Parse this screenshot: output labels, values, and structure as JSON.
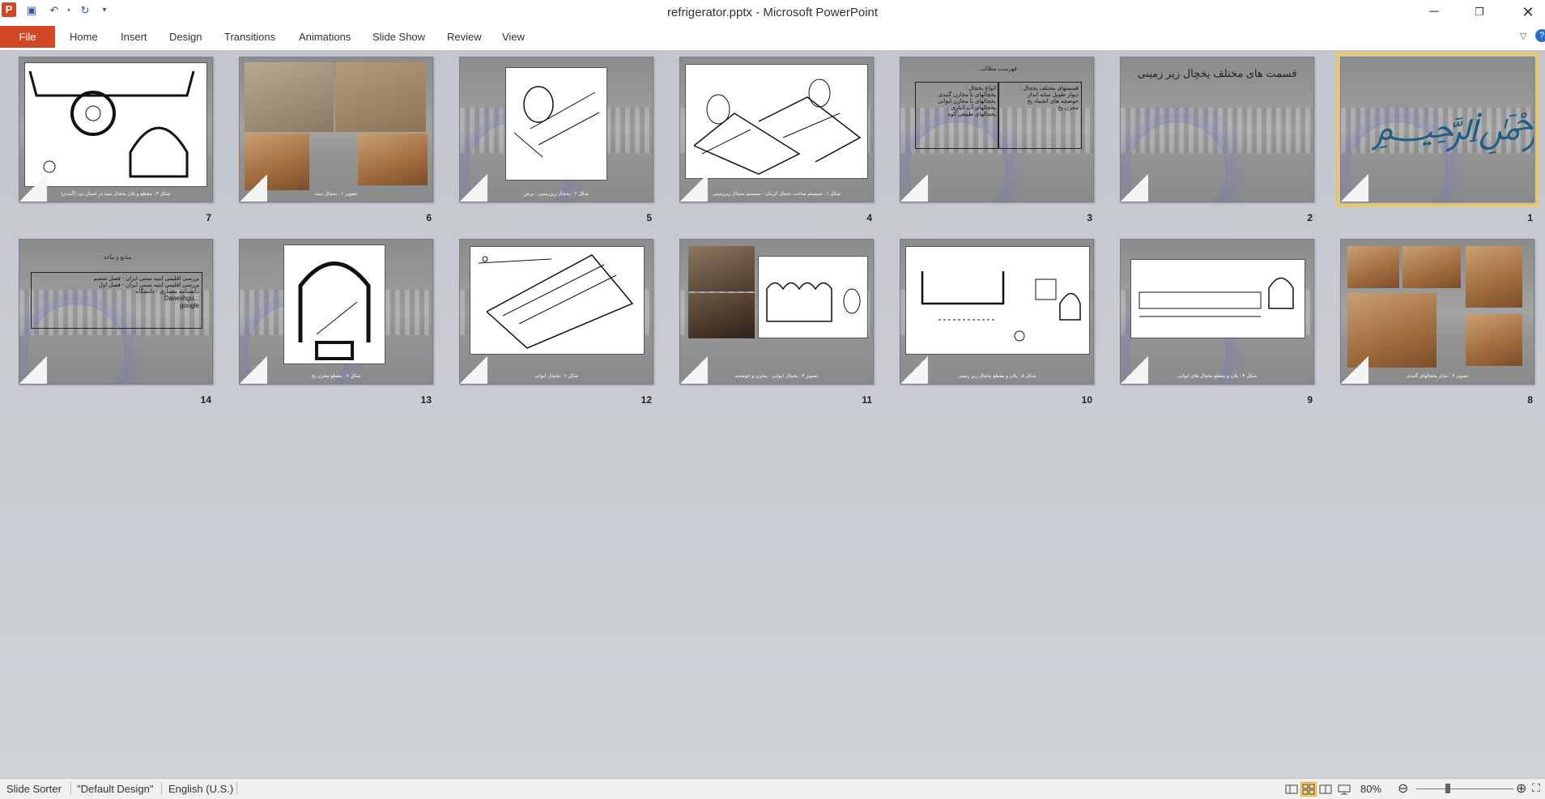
{
  "titlebar": {
    "app_icon": "P",
    "title": "refrigerator.pptx  -  Microsoft PowerPoint",
    "qat": [
      "save-icon",
      "undo-icon",
      "redo-icon",
      "customize-icon"
    ],
    "controls": [
      "minimize-icon",
      "restore-icon",
      "close-icon"
    ]
  },
  "ribbon": {
    "file": "File",
    "tabs": [
      "Home",
      "Insert",
      "Design",
      "Transitions",
      "Animations",
      "Slide Show",
      "Review",
      "View"
    ]
  },
  "slides": [
    {
      "number": "1",
      "selected": true
    },
    {
      "number": "2",
      "title": "قسمت های مختلف یخچال زیر زمینی"
    },
    {
      "number": "3",
      "title": "فهرست مطالب :",
      "col1": [
        "قسمتهای مختلف یخچال :",
        "دیوار طویل سایه انداز",
        "حوضچه های انجماد یخ",
        "مخزن یخ"
      ],
      "col2": [
        "انواع یخچال :",
        "یخچالهای با مخازن گنبدی",
        "یخچالهای با مخازن ایوانی",
        "یخچالهای آب انباری",
        "یخچالهای طبیعی کوه"
      ]
    },
    {
      "number": "4",
      "caption": "شکل ۱ : سیستم ساخت یخچال کرمان - سیستم یخچال زیرزمینی"
    },
    {
      "number": "5",
      "caption": "شکل ۲ : یخچال زیرزمینی - برش"
    },
    {
      "number": "6",
      "caption": "تصویر ۱ : یخچال میبد"
    },
    {
      "number": "7",
      "caption": "شکل ۳ : مقطع و پلان یخچال میبد در استان یزد (گنبدی)"
    },
    {
      "number": "8",
      "caption": "تصویر ۲ : نمای یخچالهای گنبدی"
    },
    {
      "number": "9",
      "caption": "شکل ۴ : پلان و مقطع یخچال های ایوانی"
    },
    {
      "number": "10",
      "caption": "شکل ۵ : پلان و مقطع یخچال زیر زمینی"
    },
    {
      "number": "11",
      "caption": "تصویر ۳ : یخچال ایوانی - مخزن و حوضچه"
    },
    {
      "number": "12",
      "caption": "شکل ۶ : یخچال ایوانی"
    },
    {
      "number": "13",
      "caption": "شکل ۷ : مقطع مخزن یخ"
    },
    {
      "number": "14",
      "title": "منابع و مآخذ :",
      "items": [
        "بررسی اقلیمی ابنیه سنتی ایران - فصل ششم",
        "بررسی اقلیمی ابنیه سنتی ایران - فصل اول",
        "دانشنامه معماری - دانشگاه"
      ],
      "extra": [
        "Daneshgu...",
        "google"
      ]
    }
  ],
  "statusbar": {
    "view": "Slide Sorter",
    "theme": "\"Default Design\"",
    "language": "English (U.S.)",
    "zoom": "80%",
    "zoom_level": 0.8,
    "view_buttons": [
      "normal-view-icon",
      "slide-sorter-icon",
      "reading-view-icon",
      "slide-show-icon"
    ]
  }
}
